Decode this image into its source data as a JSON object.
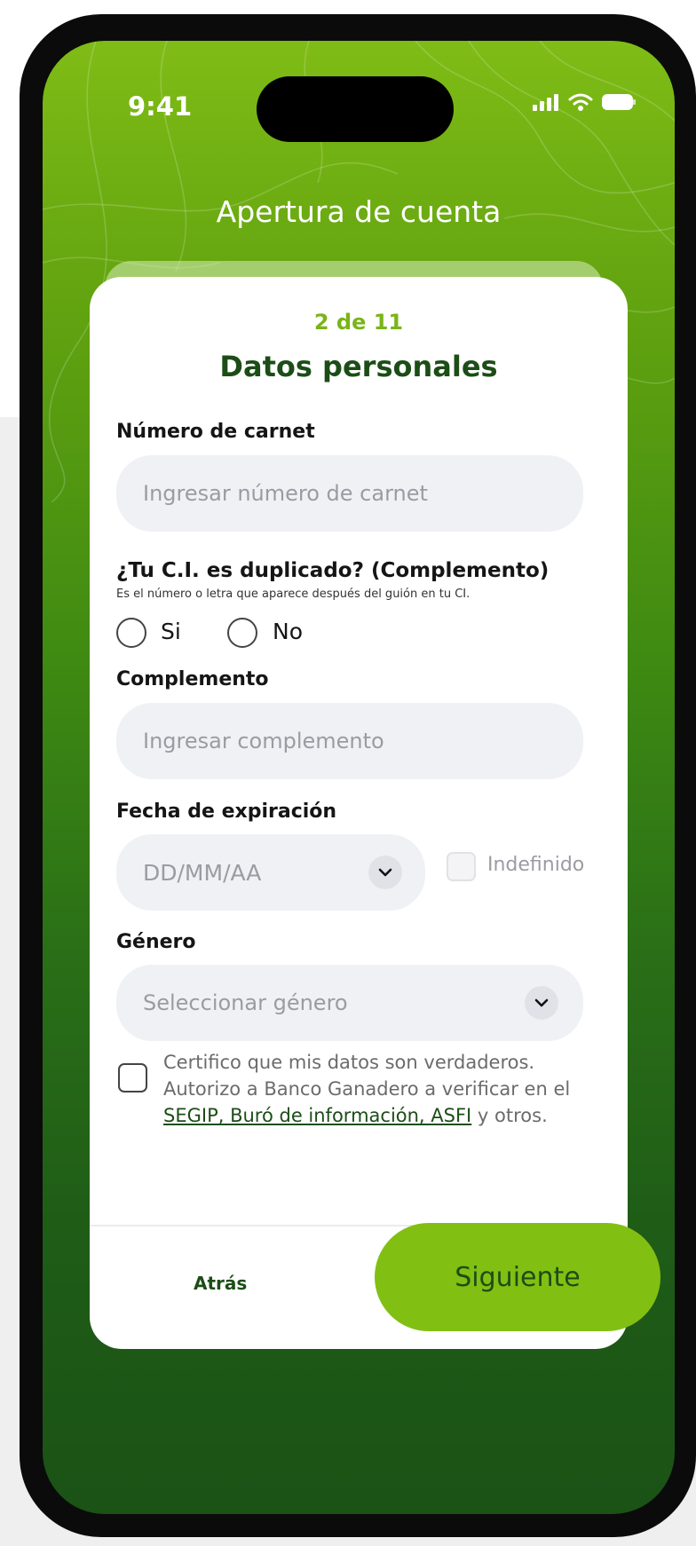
{
  "status_bar": {
    "time": "9:41"
  },
  "header": {
    "title": "Apertura de cuenta"
  },
  "form": {
    "step": "2 de 11",
    "title": "Datos personales",
    "carnet": {
      "label": "Número de carnet",
      "placeholder": "Ingresar número de carnet"
    },
    "duplicado": {
      "label": "¿Tu C.I. es duplicado? (Complemento)",
      "help": "Es el número o letra que aparece después del guión en tu CI.",
      "options": [
        "Si",
        "No"
      ]
    },
    "complemento": {
      "label": "Complemento",
      "placeholder": "Ingresar complemento"
    },
    "expiracion": {
      "label": "Fecha de expiración",
      "placeholder": "DD/MM/AA",
      "indefinido_label": "Indefinido"
    },
    "genero": {
      "label": "Género",
      "placeholder": "Seleccionar género"
    },
    "certify": {
      "text_part1": "Certifico que mis datos son verdaderos. Autorizo a Banco Ganadero a verificar en el ",
      "link": "SEGIP, Buró de información, ASFI",
      "text_part2": " y otros."
    }
  },
  "footer": {
    "back_label": "Atrás",
    "next_label": "Siguiente"
  },
  "colors": {
    "accent_green": "#82bf13",
    "dark_green": "#1c4d17",
    "step_green": "#7ab419"
  },
  "icons": [
    "signal-icon",
    "wifi-icon",
    "battery-icon",
    "chevron-down-icon"
  ]
}
